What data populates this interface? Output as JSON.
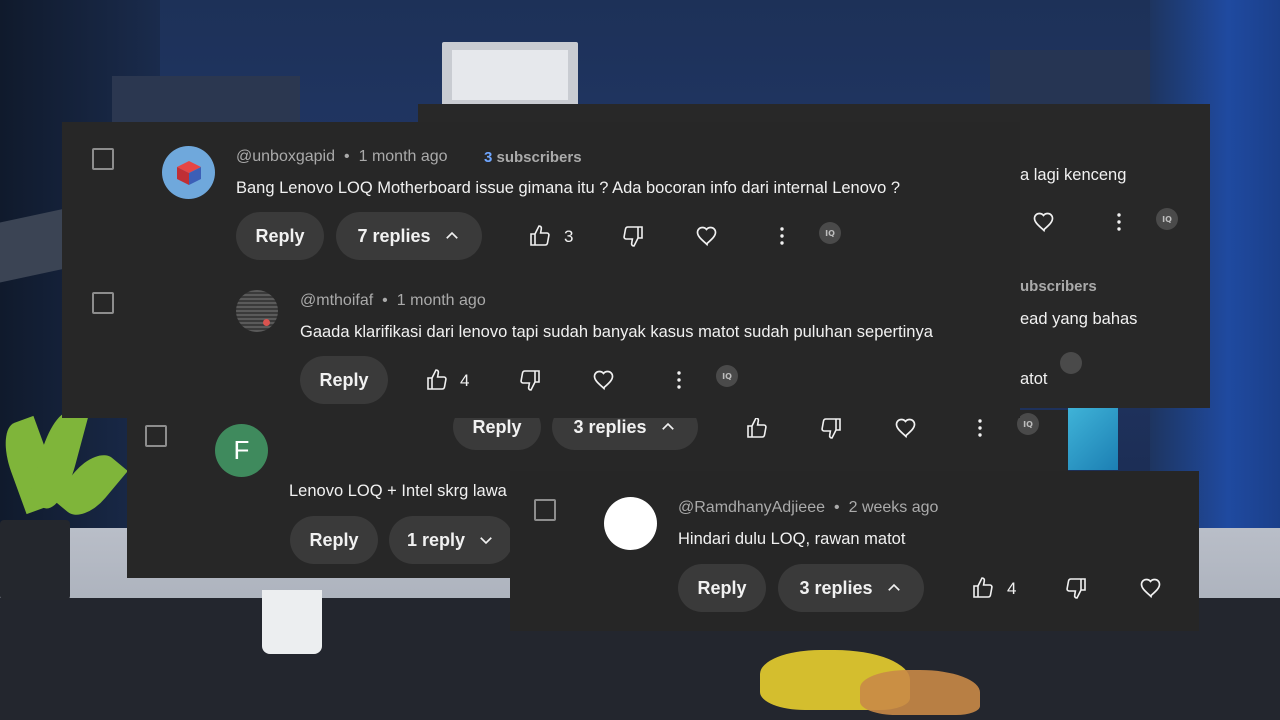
{
  "colors": {
    "panel": "#272727",
    "pill": "#3a3a3a",
    "muted": "#aaaaaa",
    "accent": "#6fa6ff"
  },
  "back_panel": {
    "fragments": [
      "a lagi kenceng",
      "ubscribers",
      "ead yang bahas",
      "atot"
    ]
  },
  "comments": [
    {
      "author": "@unboxgapid",
      "time": "1 month ago",
      "subscribers_count": "3",
      "subscribers_label": "subscribers",
      "text": "Bang Lenovo LOQ Motherboard issue gimana itu ? Ada bocoran info dari internal Lenovo ?",
      "reply_label": "Reply",
      "replies_label": "7 replies",
      "likes": "3",
      "iq_label": "IQ"
    },
    {
      "author": "@mthoifaf",
      "time": "1 month ago",
      "text": "Gaada klarifikasi dari lenovo tapi sudah banyak kasus matot sudah puluhan sepertinya",
      "reply_label": "Reply",
      "likes": "4",
      "iq_label": "IQ"
    },
    {
      "avatar_letter": "F",
      "text": "Lenovo LOQ + Intel skrg lawa",
      "reply_label": "Reply",
      "replies_label": "1 reply",
      "upper_reply_label": "Reply",
      "upper_replies_label": "3 replies",
      "iq_label": "IQ"
    },
    {
      "author": "@RamdhanyAdjieee",
      "time": "2 weeks ago",
      "text": "Hindari dulu LOQ, rawan matot",
      "reply_label": "Reply",
      "replies_label": "3 replies",
      "likes": "4"
    }
  ],
  "icons": [
    "checkbox",
    "thumb-up-icon",
    "thumb-down-icon",
    "heart-icon",
    "more-vert-icon",
    "chevron-up-icon",
    "chevron-down-icon",
    "iq-badge-icon"
  ]
}
